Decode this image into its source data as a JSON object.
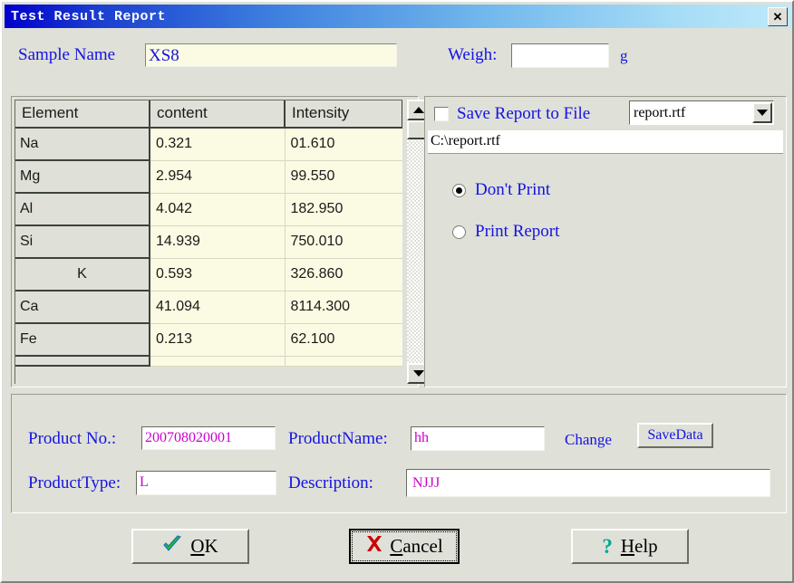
{
  "window": {
    "title": "Test Result Report",
    "close_label": "✕"
  },
  "header": {
    "sample_name_label": "Sample Name",
    "sample_name_value": "XS8",
    "weigh_label": "Weigh:",
    "weigh_value": "",
    "weigh_unit": "g"
  },
  "table": {
    "columns": [
      "Element",
      "content",
      "Intensity"
    ],
    "rows": [
      {
        "element": "Na",
        "content": "0.321",
        "intensity": "01.610"
      },
      {
        "element": "Mg",
        "content": "2.954",
        "intensity": "99.550"
      },
      {
        "element": "Al",
        "content": "4.042",
        "intensity": "182.950"
      },
      {
        "element": "Si",
        "content": "14.939",
        "intensity": "750.010"
      },
      {
        "element": "K",
        "content": "0.593",
        "intensity": "326.860"
      },
      {
        "element": "Ca",
        "content": "41.094",
        "intensity": "8114.300"
      },
      {
        "element": "Fe",
        "content": "0.213",
        "intensity": "62.100"
      }
    ],
    "scrollbar": {
      "up_arrow": "▲",
      "down_arrow": "▼"
    }
  },
  "report_options": {
    "save_to_file_label": "Save Report to File",
    "save_to_file_checked": false,
    "file_format_value": "report.rtf",
    "file_format_arrow": "▼",
    "path_value": "C:\\report.rtf",
    "print_mode": [
      {
        "label": "Don't Print",
        "selected": true
      },
      {
        "label": "Print Report",
        "selected": false
      }
    ]
  },
  "product": {
    "product_no_label": "Product No.:",
    "product_no_value": "200708020001",
    "product_name_label": "ProductName:",
    "product_name_value": "hh",
    "change_label": "Change",
    "save_data_label": "SaveData",
    "product_type_label": "ProductType:",
    "product_type_value": "L",
    "description_label": "Description:",
    "description_value": "NJJJ"
  },
  "buttons": {
    "ok": "OK",
    "ok_accel": "O",
    "cancel": "Cancel",
    "cancel_accel": "C",
    "help": "Help",
    "help_accel": "H",
    "ok_icon": "check-icon",
    "cancel_icon": "x-icon",
    "help_icon": "question-icon"
  },
  "colors": {
    "title_start": "#0000cc",
    "title_end": "#bfe9fa",
    "label_blue": "#1414e0",
    "value_magenta": "#cc00cc",
    "field_cream": "#fbfbe3",
    "face": "#dfe0d8",
    "ok_check": "#22bb22",
    "cancel_x": "#cc0000",
    "help_q": "#00a890"
  }
}
